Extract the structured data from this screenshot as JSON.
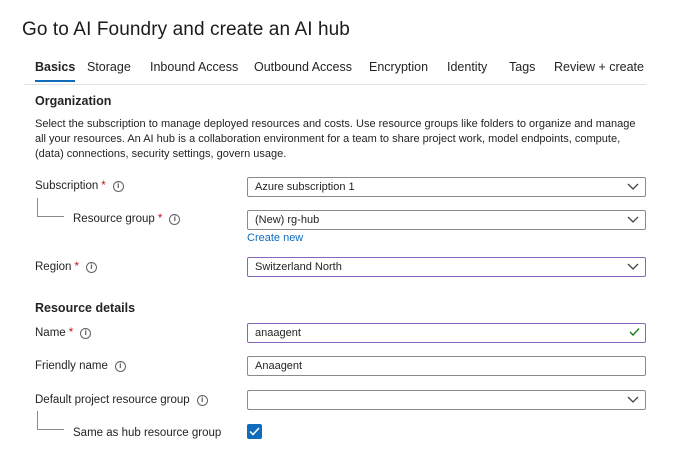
{
  "title": "Go to AI Foundry and create an AI hub",
  "tabs": [
    {
      "label": "Basics",
      "active": true
    },
    {
      "label": "Storage",
      "active": false
    },
    {
      "label": "Inbound Access",
      "active": false
    },
    {
      "label": "Outbound Access",
      "active": false
    },
    {
      "label": "Encryption",
      "active": false
    },
    {
      "label": "Identity",
      "active": false
    },
    {
      "label": "Tags",
      "active": false
    },
    {
      "label": "Review + create",
      "active": false
    }
  ],
  "organization": {
    "heading": "Organization",
    "description": "Select the subscription to manage deployed resources and costs. Use resource groups like folders to organize and manage all your resources. An AI hub is a collaboration environment for a team to share project work, model endpoints, compute, (data) connections, security settings, govern usage.",
    "subscription": {
      "label": "Subscription",
      "required_mark": "*",
      "value": "Azure subscription 1"
    },
    "resource_group": {
      "label": "Resource group",
      "required_mark": "*",
      "value": "(New) rg-hub",
      "create_new": "Create new"
    },
    "region": {
      "label": "Region",
      "required_mark": "*",
      "value": "Switzerland North"
    }
  },
  "resource_details": {
    "heading": "Resource details",
    "name": {
      "label": "Name",
      "required_mark": "*",
      "value": "anaagent"
    },
    "friendly_name": {
      "label": "Friendly name",
      "value": "Anaagent"
    },
    "default_project_rg": {
      "label": "Default project resource group",
      "value": ""
    },
    "same_as_hub": {
      "label": "Same as hub resource group",
      "checked": true
    }
  },
  "colors": {
    "accent": "#0f6cbd",
    "required": "#c50f1f",
    "focus_border": "#8764b8",
    "valid_check": "#107c10"
  }
}
